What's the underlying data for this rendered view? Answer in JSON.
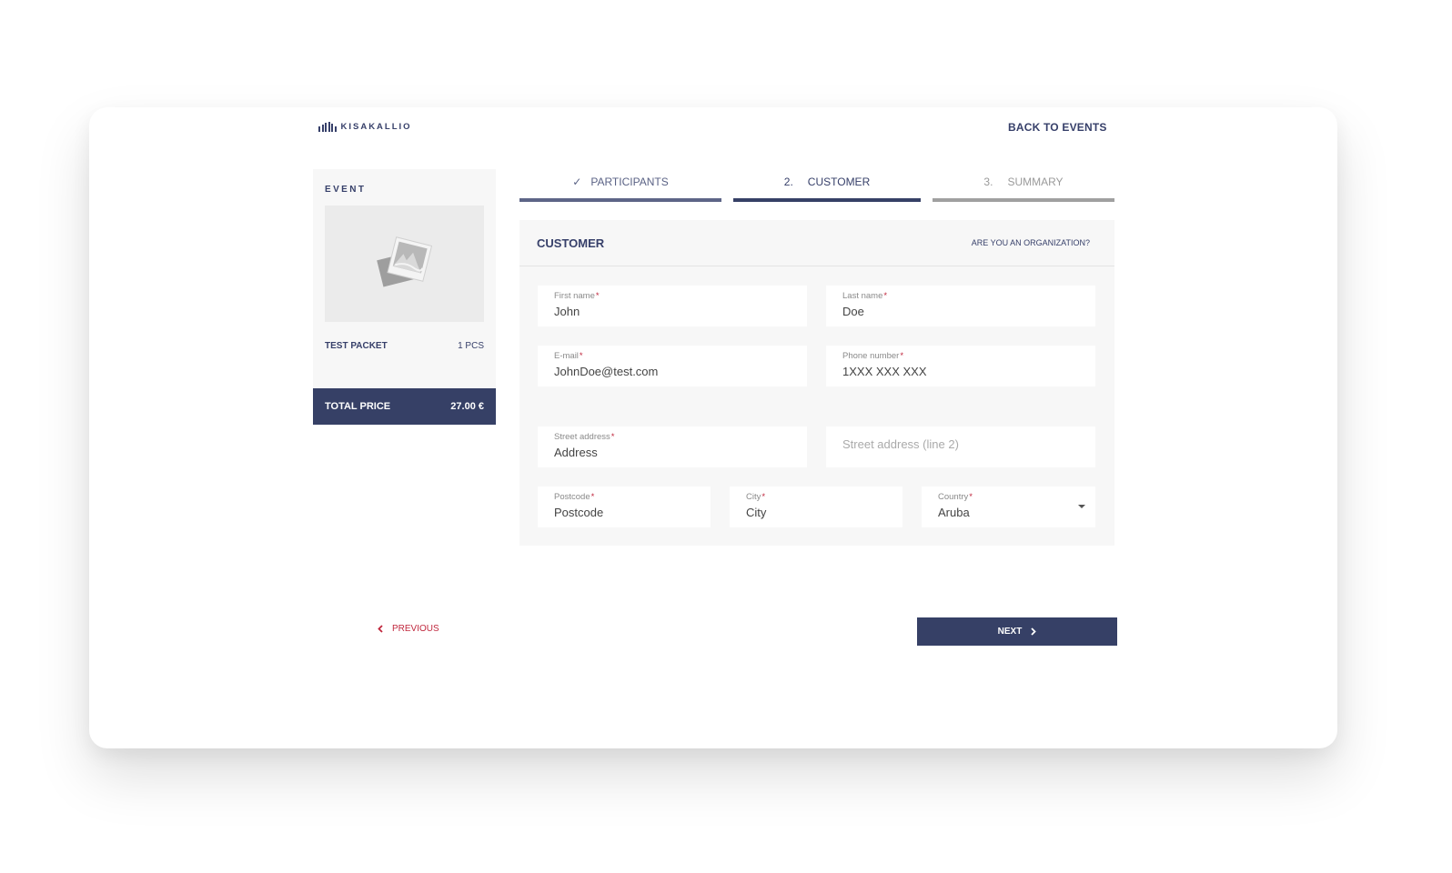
{
  "header": {
    "brand": "KISAKALLIO",
    "back_link": "BACK TO EVENTS"
  },
  "sidebar": {
    "title": "EVENT",
    "image_icon": "image-placeholder-icon",
    "packet_name": "TEST PACKET",
    "packet_qty": "1 PCS",
    "total_label": "TOTAL PRICE",
    "total_value": "27.00 €"
  },
  "steps": [
    {
      "prefix": "✓",
      "label": "PARTICIPANTS",
      "state": "completed"
    },
    {
      "prefix": "2.",
      "label": "CUSTOMER",
      "state": "active"
    },
    {
      "prefix": "3.",
      "label": "SUMMARY",
      "state": "upcoming"
    }
  ],
  "form": {
    "title": "CUSTOMER",
    "org_link": "ARE YOU AN ORGANIZATION?",
    "required_mark": "*",
    "fields": {
      "first_name": {
        "label": "First name",
        "value": "John"
      },
      "last_name": {
        "label": "Last name",
        "value": "Doe"
      },
      "email": {
        "label": "E-mail",
        "value": "JohnDoe@test.com"
      },
      "phone": {
        "label": "Phone number",
        "value": "1XXX XXX XXX"
      },
      "street": {
        "label": "Street address",
        "value": "Address"
      },
      "street2": {
        "placeholder": "Street address (line 2)",
        "value": ""
      },
      "postcode": {
        "label": "Postcode",
        "value": "Postcode"
      },
      "city": {
        "label": "City",
        "value": "City"
      },
      "country": {
        "label": "Country",
        "value": "Aruba"
      }
    }
  },
  "nav": {
    "previous": "PREVIOUS",
    "next": "NEXT"
  },
  "colors": {
    "primary": "#364066",
    "accent_red": "#c0283e",
    "panel_bg": "#f7f7f7"
  }
}
